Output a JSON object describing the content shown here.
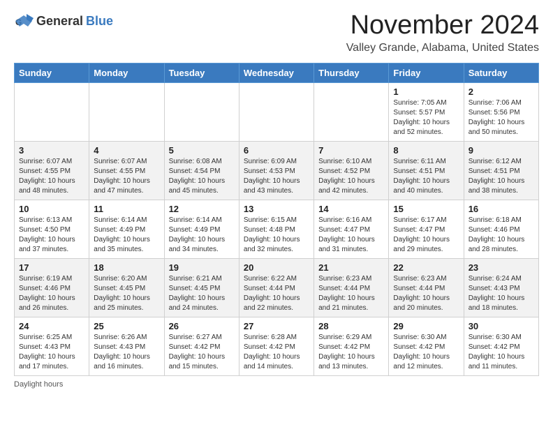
{
  "header": {
    "logo_general": "General",
    "logo_blue": "Blue",
    "month_title": "November 2024",
    "location": "Valley Grande, Alabama, United States"
  },
  "calendar": {
    "days_of_week": [
      "Sunday",
      "Monday",
      "Tuesday",
      "Wednesday",
      "Thursday",
      "Friday",
      "Saturday"
    ],
    "weeks": [
      [
        {
          "day": "",
          "info": ""
        },
        {
          "day": "",
          "info": ""
        },
        {
          "day": "",
          "info": ""
        },
        {
          "day": "",
          "info": ""
        },
        {
          "day": "",
          "info": ""
        },
        {
          "day": "1",
          "info": "Sunrise: 7:05 AM\nSunset: 5:57 PM\nDaylight: 10 hours\nand 52 minutes."
        },
        {
          "day": "2",
          "info": "Sunrise: 7:06 AM\nSunset: 5:56 PM\nDaylight: 10 hours\nand 50 minutes."
        }
      ],
      [
        {
          "day": "3",
          "info": "Sunrise: 6:07 AM\nSunset: 4:55 PM\nDaylight: 10 hours\nand 48 minutes."
        },
        {
          "day": "4",
          "info": "Sunrise: 6:07 AM\nSunset: 4:55 PM\nDaylight: 10 hours\nand 47 minutes."
        },
        {
          "day": "5",
          "info": "Sunrise: 6:08 AM\nSunset: 4:54 PM\nDaylight: 10 hours\nand 45 minutes."
        },
        {
          "day": "6",
          "info": "Sunrise: 6:09 AM\nSunset: 4:53 PM\nDaylight: 10 hours\nand 43 minutes."
        },
        {
          "day": "7",
          "info": "Sunrise: 6:10 AM\nSunset: 4:52 PM\nDaylight: 10 hours\nand 42 minutes."
        },
        {
          "day": "8",
          "info": "Sunrise: 6:11 AM\nSunset: 4:51 PM\nDaylight: 10 hours\nand 40 minutes."
        },
        {
          "day": "9",
          "info": "Sunrise: 6:12 AM\nSunset: 4:51 PM\nDaylight: 10 hours\nand 38 minutes."
        }
      ],
      [
        {
          "day": "10",
          "info": "Sunrise: 6:13 AM\nSunset: 4:50 PM\nDaylight: 10 hours\nand 37 minutes."
        },
        {
          "day": "11",
          "info": "Sunrise: 6:14 AM\nSunset: 4:49 PM\nDaylight: 10 hours\nand 35 minutes."
        },
        {
          "day": "12",
          "info": "Sunrise: 6:14 AM\nSunset: 4:49 PM\nDaylight: 10 hours\nand 34 minutes."
        },
        {
          "day": "13",
          "info": "Sunrise: 6:15 AM\nSunset: 4:48 PM\nDaylight: 10 hours\nand 32 minutes."
        },
        {
          "day": "14",
          "info": "Sunrise: 6:16 AM\nSunset: 4:47 PM\nDaylight: 10 hours\nand 31 minutes."
        },
        {
          "day": "15",
          "info": "Sunrise: 6:17 AM\nSunset: 4:47 PM\nDaylight: 10 hours\nand 29 minutes."
        },
        {
          "day": "16",
          "info": "Sunrise: 6:18 AM\nSunset: 4:46 PM\nDaylight: 10 hours\nand 28 minutes."
        }
      ],
      [
        {
          "day": "17",
          "info": "Sunrise: 6:19 AM\nSunset: 4:46 PM\nDaylight: 10 hours\nand 26 minutes."
        },
        {
          "day": "18",
          "info": "Sunrise: 6:20 AM\nSunset: 4:45 PM\nDaylight: 10 hours\nand 25 minutes."
        },
        {
          "day": "19",
          "info": "Sunrise: 6:21 AM\nSunset: 4:45 PM\nDaylight: 10 hours\nand 24 minutes."
        },
        {
          "day": "20",
          "info": "Sunrise: 6:22 AM\nSunset: 4:44 PM\nDaylight: 10 hours\nand 22 minutes."
        },
        {
          "day": "21",
          "info": "Sunrise: 6:23 AM\nSunset: 4:44 PM\nDaylight: 10 hours\nand 21 minutes."
        },
        {
          "day": "22",
          "info": "Sunrise: 6:23 AM\nSunset: 4:44 PM\nDaylight: 10 hours\nand 20 minutes."
        },
        {
          "day": "23",
          "info": "Sunrise: 6:24 AM\nSunset: 4:43 PM\nDaylight: 10 hours\nand 18 minutes."
        }
      ],
      [
        {
          "day": "24",
          "info": "Sunrise: 6:25 AM\nSunset: 4:43 PM\nDaylight: 10 hours\nand 17 minutes."
        },
        {
          "day": "25",
          "info": "Sunrise: 6:26 AM\nSunset: 4:43 PM\nDaylight: 10 hours\nand 16 minutes."
        },
        {
          "day": "26",
          "info": "Sunrise: 6:27 AM\nSunset: 4:42 PM\nDaylight: 10 hours\nand 15 minutes."
        },
        {
          "day": "27",
          "info": "Sunrise: 6:28 AM\nSunset: 4:42 PM\nDaylight: 10 hours\nand 14 minutes."
        },
        {
          "day": "28",
          "info": "Sunrise: 6:29 AM\nSunset: 4:42 PM\nDaylight: 10 hours\nand 13 minutes."
        },
        {
          "day": "29",
          "info": "Sunrise: 6:30 AM\nSunset: 4:42 PM\nDaylight: 10 hours\nand 12 minutes."
        },
        {
          "day": "30",
          "info": "Sunrise: 6:30 AM\nSunset: 4:42 PM\nDaylight: 10 hours\nand 11 minutes."
        }
      ]
    ]
  },
  "footer": {
    "note": "Daylight hours"
  }
}
